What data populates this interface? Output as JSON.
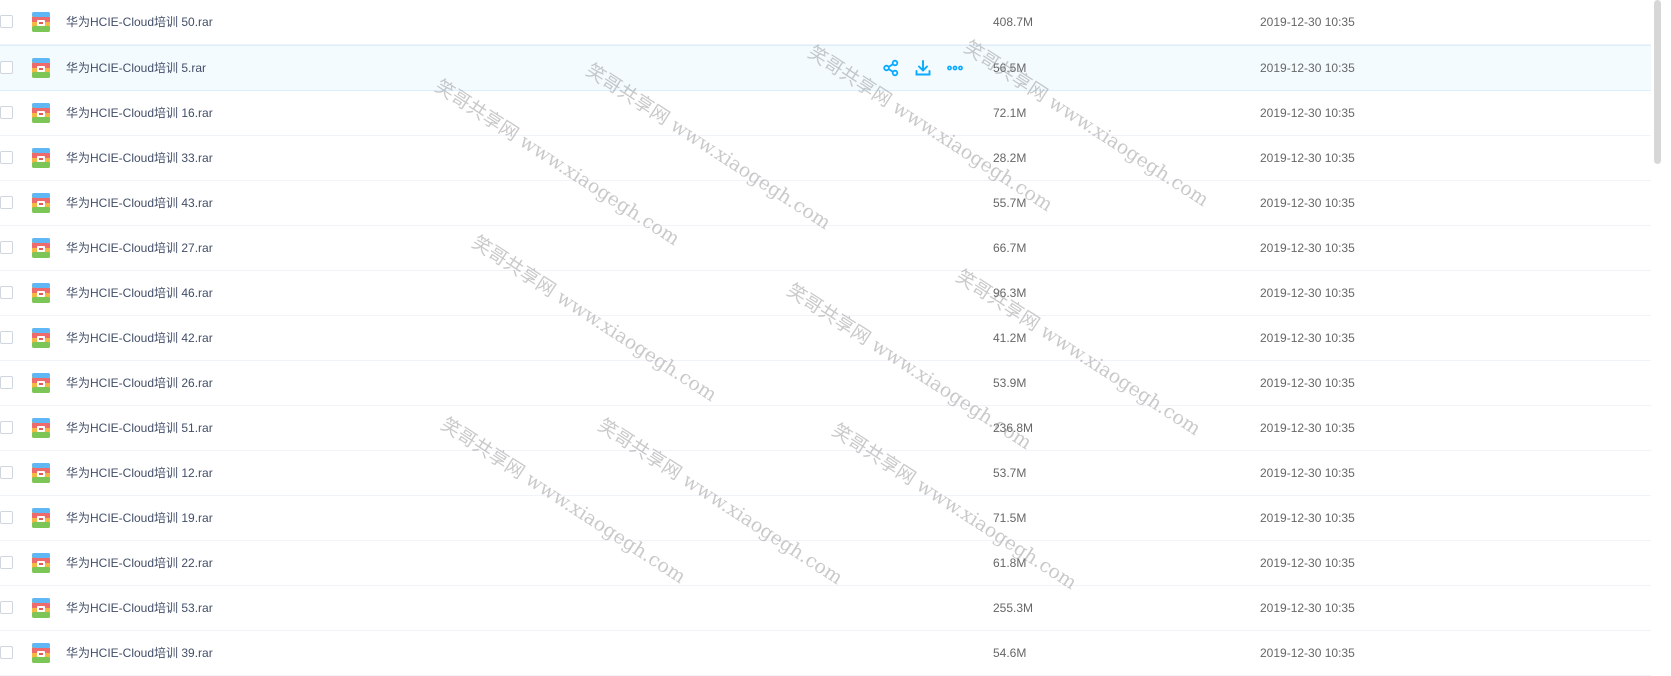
{
  "files": [
    {
      "name": "华为HCIE-Cloud培训 50.rar",
      "size": "408.7M",
      "date": "2019-12-30 10:35"
    },
    {
      "name": "华为HCIE-Cloud培训 5.rar",
      "size": "56.5M",
      "date": "2019-12-30 10:35"
    },
    {
      "name": "华为HCIE-Cloud培训 16.rar",
      "size": "72.1M",
      "date": "2019-12-30 10:35"
    },
    {
      "name": "华为HCIE-Cloud培训 33.rar",
      "size": "28.2M",
      "date": "2019-12-30 10:35"
    },
    {
      "name": "华为HCIE-Cloud培训 43.rar",
      "size": "55.7M",
      "date": "2019-12-30 10:35"
    },
    {
      "name": "华为HCIE-Cloud培训 27.rar",
      "size": "66.7M",
      "date": "2019-12-30 10:35"
    },
    {
      "name": "华为HCIE-Cloud培训 46.rar",
      "size": "96.3M",
      "date": "2019-12-30 10:35"
    },
    {
      "name": "华为HCIE-Cloud培训 42.rar",
      "size": "41.2M",
      "date": "2019-12-30 10:35"
    },
    {
      "name": "华为HCIE-Cloud培训 26.rar",
      "size": "53.9M",
      "date": "2019-12-30 10:35"
    },
    {
      "name": "华为HCIE-Cloud培训 51.rar",
      "size": "236.8M",
      "date": "2019-12-30 10:35"
    },
    {
      "name": "华为HCIE-Cloud培训 12.rar",
      "size": "53.7M",
      "date": "2019-12-30 10:35"
    },
    {
      "name": "华为HCIE-Cloud培训 19.rar",
      "size": "71.5M",
      "date": "2019-12-30 10:35"
    },
    {
      "name": "华为HCIE-Cloud培训 22.rar",
      "size": "61.8M",
      "date": "2019-12-30 10:35"
    },
    {
      "name": "华为HCIE-Cloud培训 53.rar",
      "size": "255.3M",
      "date": "2019-12-30 10:35"
    },
    {
      "name": "华为HCIE-Cloud培训 39.rar",
      "size": "54.6M",
      "date": "2019-12-30 10:35"
    }
  ],
  "hover_row_index": 1,
  "hover_actions": [
    {
      "icon": "share-icon"
    },
    {
      "icon": "download-icon"
    },
    {
      "icon": "more-icon"
    }
  ],
  "colors": {
    "accent": "#09aaff",
    "file_name": "#424e67",
    "meta_text": "#666666",
    "hover_bg": "#f4fbff"
  },
  "watermark": {
    "text": "笑哥共享网 www.xiaogegh.com"
  }
}
